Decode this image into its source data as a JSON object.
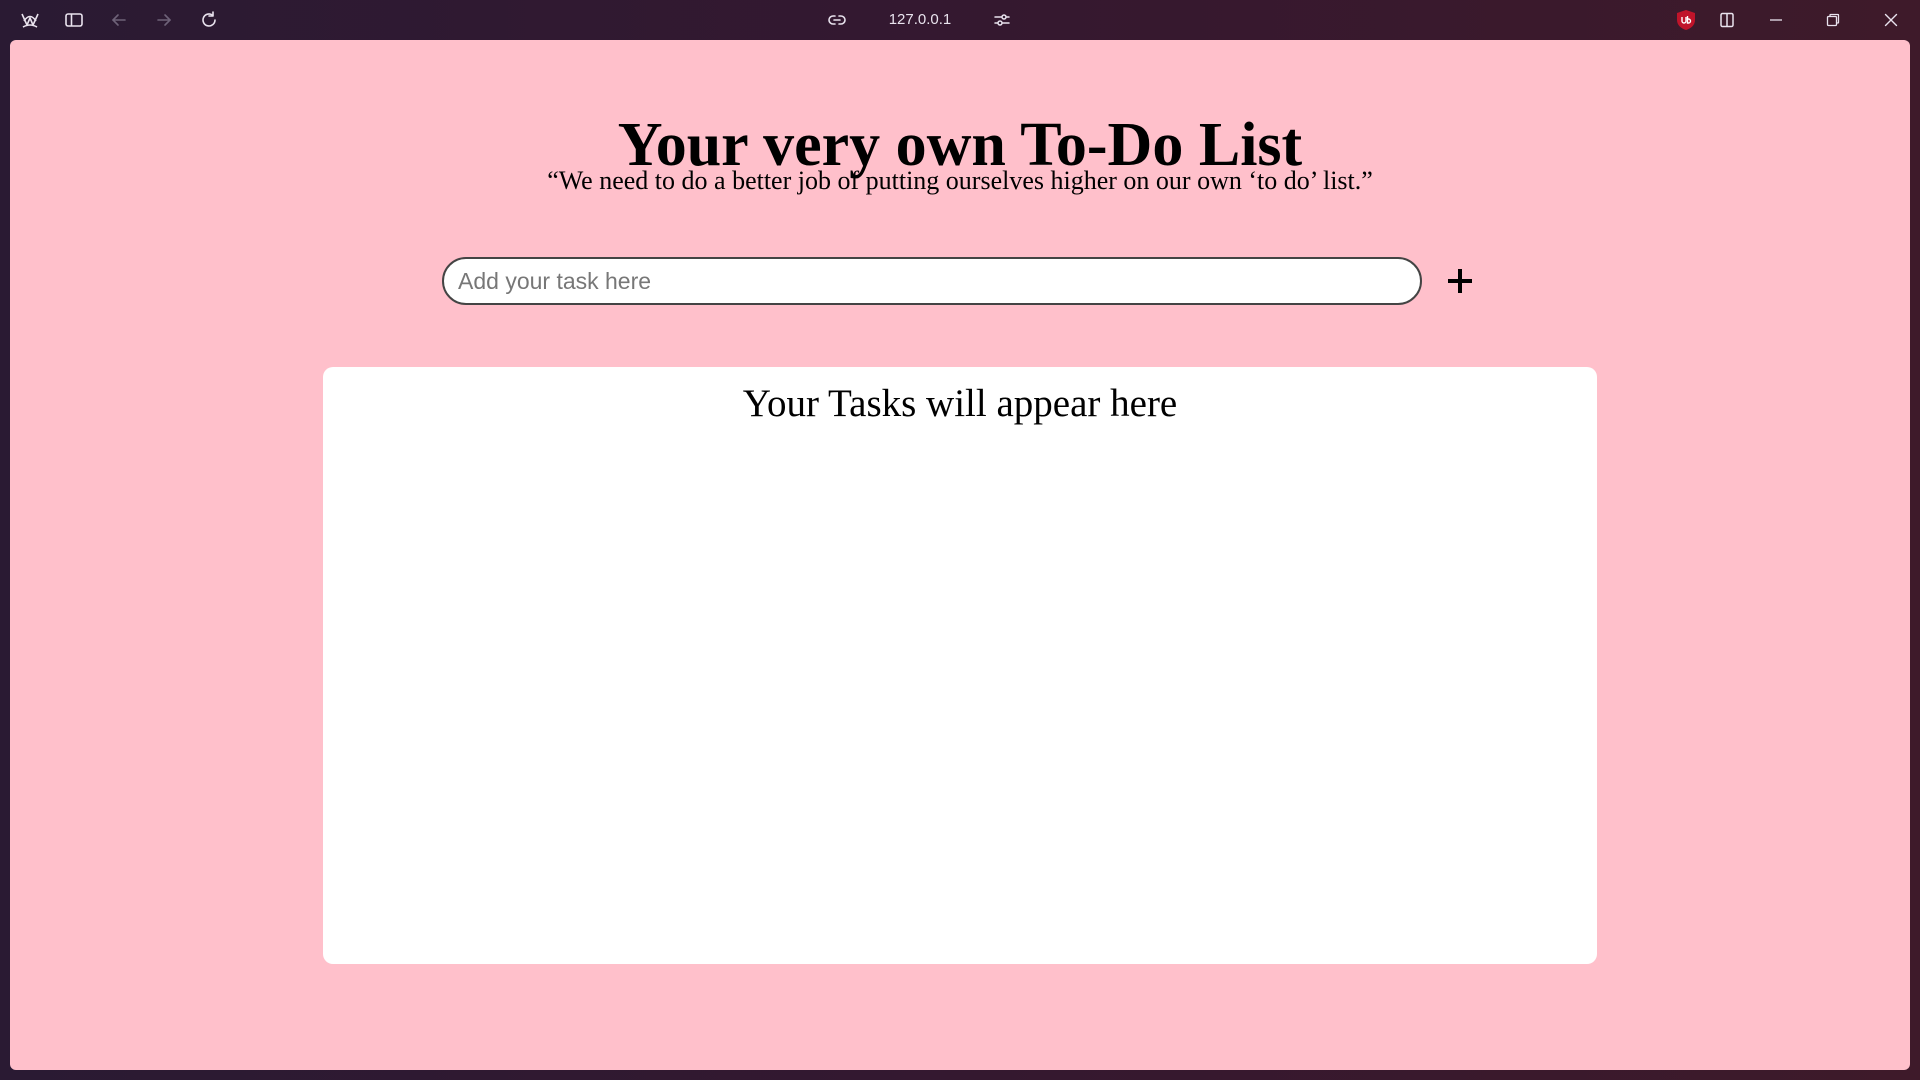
{
  "browser": {
    "url": "127.0.0.1",
    "icons": {
      "logo": "browser-logo-icon",
      "sidebar": "sidebar-toggle-icon",
      "back": "arrow-left-icon",
      "forward": "arrow-right-icon",
      "reload": "reload-icon",
      "link": "link-icon",
      "site_settings": "sliders-icon",
      "extension": "ublock-icon",
      "split_view": "split-view-icon",
      "minimize": "minimize-icon",
      "restore": "restore-icon",
      "close": "close-icon"
    },
    "colors": {
      "titlebar": "#2a1a33",
      "extension_badge": "#c0142a"
    }
  },
  "page": {
    "title": "Your very own To-Do List",
    "quote": "“We need to do a better job of putting ourselves higher on our own ‘to do’ list.”",
    "task_input": {
      "value": "",
      "placeholder": "Add your task here"
    },
    "add_button_icon": "plus-icon",
    "tasks_panel": {
      "heading": "Your Tasks will appear here",
      "items": []
    },
    "colors": {
      "background": "#ffc0cb",
      "panel": "#ffffff",
      "text": "#000000"
    }
  }
}
